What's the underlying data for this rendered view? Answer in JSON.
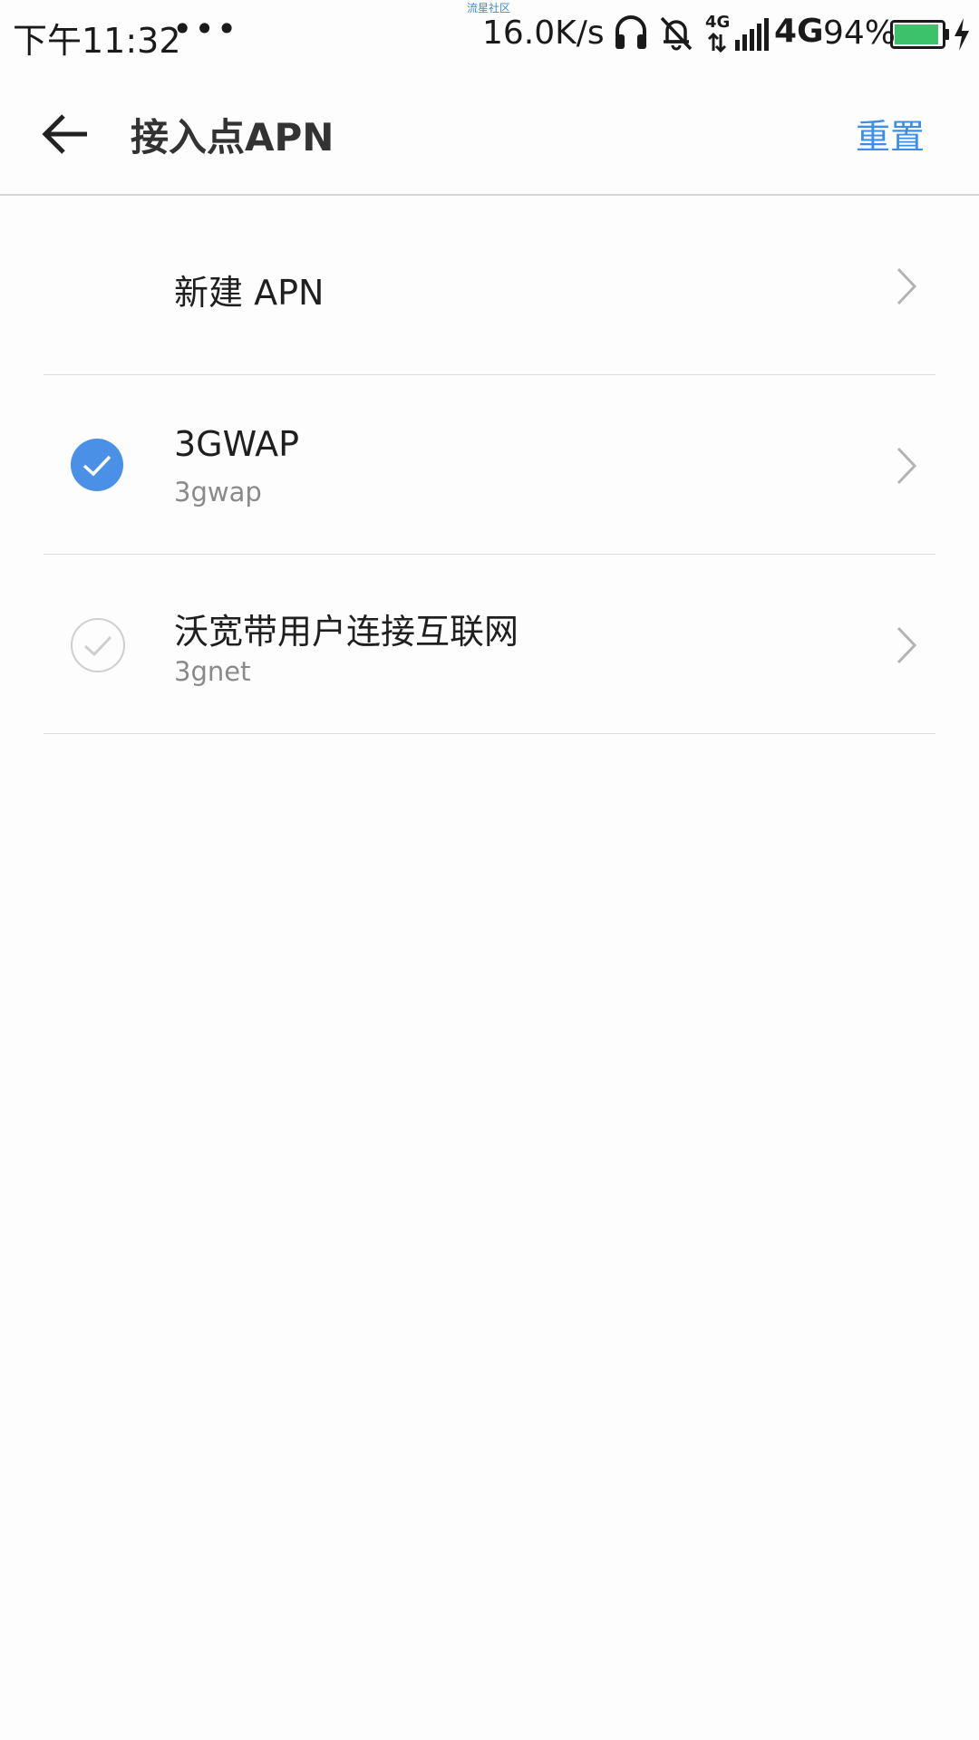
{
  "status_bar": {
    "time": "下午11:32",
    "more": "•••",
    "watermark": "流星社区",
    "net_speed": "16.0K/s",
    "network_type_small": "4G",
    "network_type": "4G",
    "battery": "94%",
    "battery_level": 0.94,
    "icons": [
      "headphones-icon",
      "bell-off-icon",
      "signal-icon",
      "battery-icon",
      "charging-icon"
    ]
  },
  "app_bar": {
    "title": "接入点APN",
    "reset_label": "重置",
    "back_icon": "arrow-left-icon"
  },
  "apn_list": [
    {
      "title": "新建 APN",
      "subtitle": "",
      "selected": null
    },
    {
      "title": "3GWAP",
      "subtitle": "3gwap",
      "selected": true
    },
    {
      "title": "沃宽带用户连接互联网",
      "subtitle": "3gnet",
      "selected": false
    }
  ],
  "colors": {
    "accent": "#4a90e6",
    "reset_text": "#3d8ee6",
    "battery_fill": "#3cc26a"
  }
}
